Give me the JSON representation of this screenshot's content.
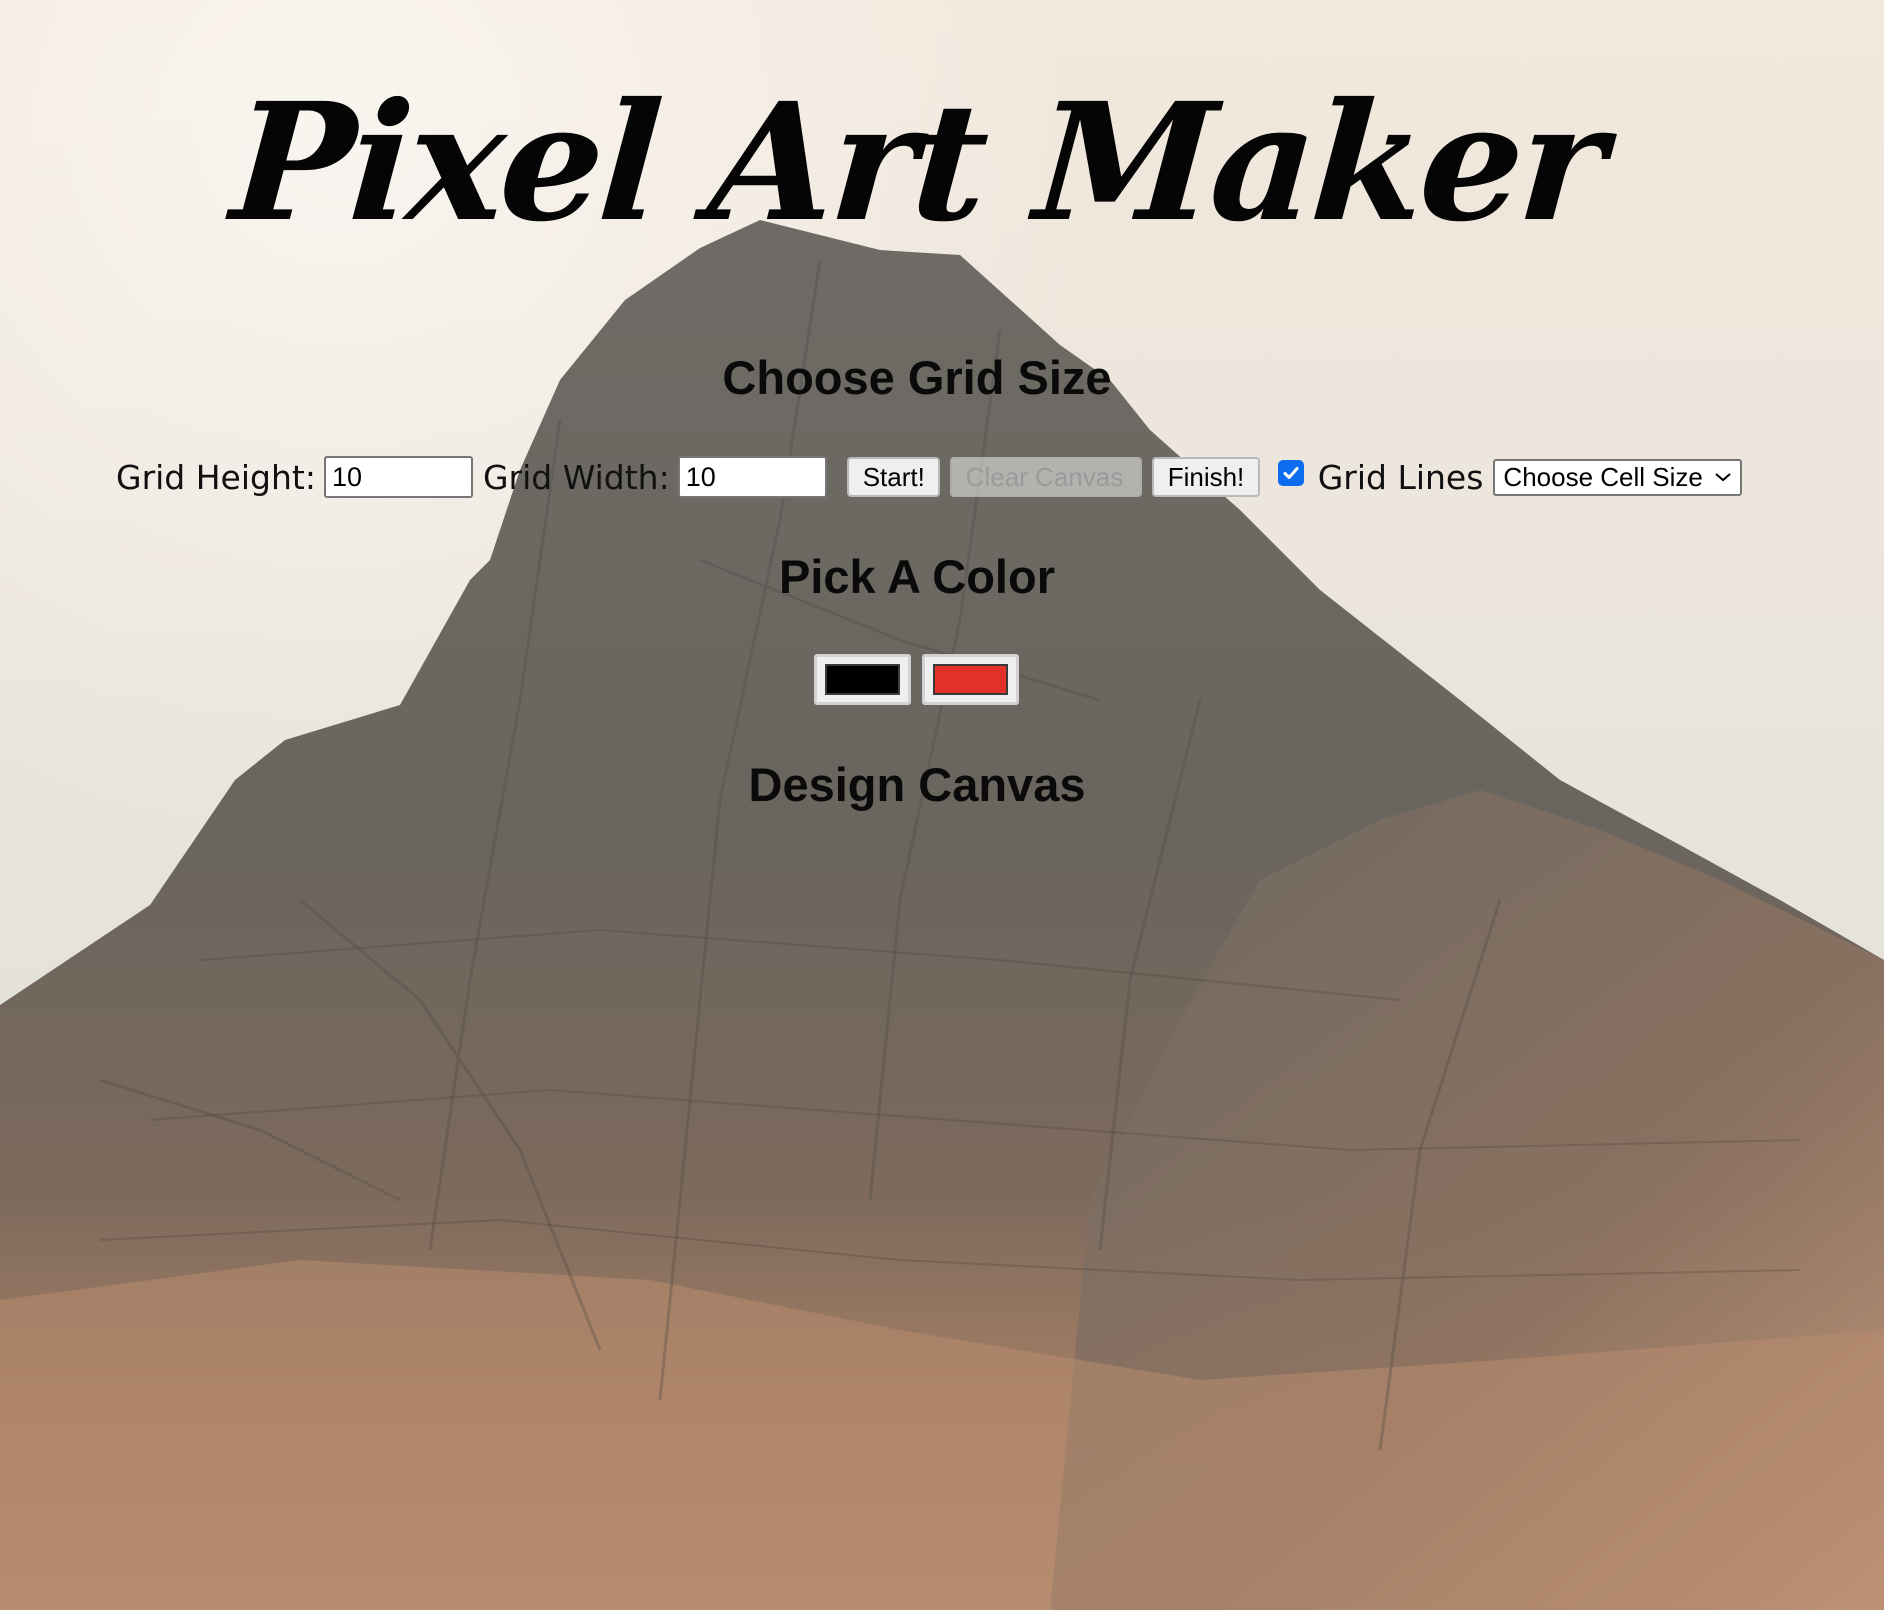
{
  "page": {
    "title": "Pixel Art Maker"
  },
  "grid_section": {
    "heading": "Choose Grid Size",
    "height_label": "Grid Height:",
    "height_value": "10",
    "width_label": "Grid Width:",
    "width_value": "10",
    "start_label": "Start!",
    "clear_label": "Clear Canvas",
    "finish_label": "Finish!",
    "grid_lines_label": "Grid Lines",
    "grid_lines_checked": true,
    "cell_size_selected": "Choose Cell Size"
  },
  "color_section": {
    "heading": "Pick A Color",
    "swatches": [
      {
        "color": "#000000"
      },
      {
        "color": "#e3312a"
      }
    ]
  },
  "canvas_section": {
    "heading": "Design Canvas"
  },
  "icons": {
    "checkbox": "checkmark-icon",
    "select": "chevron-down-icon"
  },
  "colors": {
    "checkbox_accent": "#0b6cf0"
  }
}
